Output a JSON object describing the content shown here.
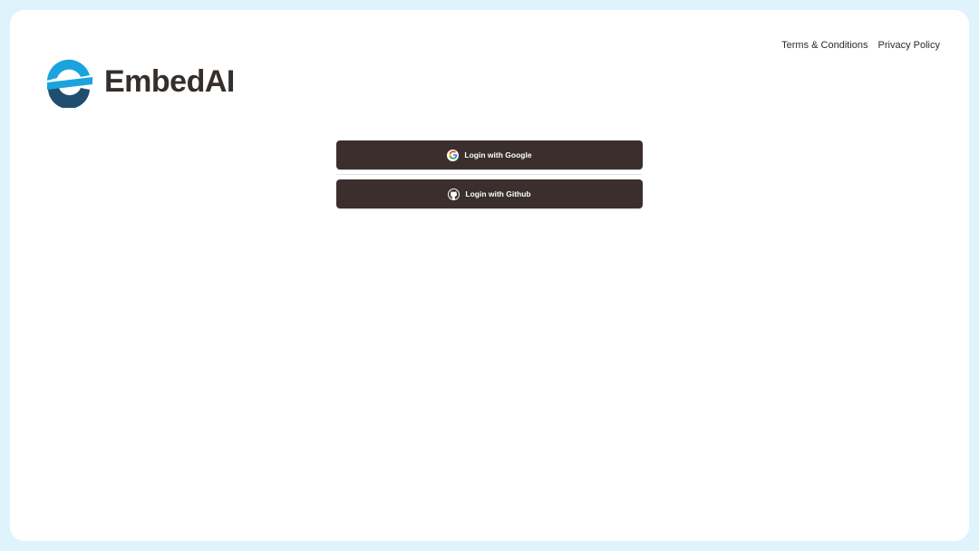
{
  "header": {
    "links": [
      {
        "label": "Terms & Conditions"
      },
      {
        "label": "Privacy Policy"
      }
    ]
  },
  "brand": {
    "name": "EmbedAI",
    "logo_icon": "embedai-logo-icon",
    "colors": {
      "logo_light": "#1aa3df",
      "logo_dark": "#1f4e6e",
      "text": "#352f2c"
    }
  },
  "login": {
    "google_label": "Login with Google",
    "google_icon": "google-icon",
    "github_label": "Login with Github",
    "github_icon": "github-icon",
    "button_color": "#3a2f2c"
  }
}
